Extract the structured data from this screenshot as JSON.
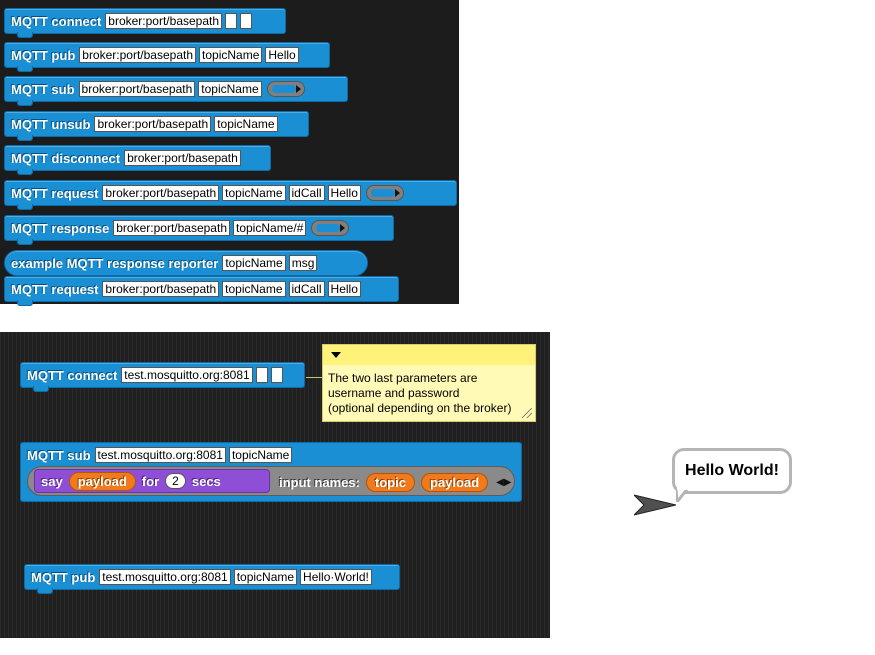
{
  "palette": {
    "blocks": [
      {
        "label": "MQTT connect",
        "slots": [
          "broker:port/basepath",
          "",
          ""
        ],
        "ring": false
      },
      {
        "label": "MQTT pub",
        "slots": [
          "broker:port/basepath",
          "topicName",
          "Hello"
        ],
        "ring": false
      },
      {
        "label": "MQTT sub",
        "slots": [
          "broker:port/basepath",
          "topicName"
        ],
        "ring": true
      },
      {
        "label": "MQTT unsub",
        "slots": [
          "broker:port/basepath",
          "topicName"
        ],
        "ring": false
      },
      {
        "label": "MQTT disconnect",
        "slots": [
          "broker:port/basepath"
        ],
        "ring": false
      },
      {
        "label": "MQTT request",
        "slots": [
          "broker:port/basepath",
          "topicName",
          "idCall",
          "Hello"
        ],
        "ring": true
      },
      {
        "label": "MQTT response",
        "slots": [
          "broker:port/basepath",
          "topicName/#"
        ],
        "ring": true
      },
      {
        "label": "example MQTT response reporter",
        "slots": [
          "topicName",
          "msg"
        ],
        "ring": false
      },
      {
        "label": "MQTT request",
        "slots": [
          "broker:port/basepath",
          "topicName",
          "idCall",
          "Hello"
        ],
        "ring": false
      }
    ]
  },
  "script": {
    "connect": {
      "label": "MQTT connect",
      "broker": "test.mosquitto.org:8081",
      "user": "",
      "password": ""
    },
    "comment": {
      "line1": "The two last parameters are",
      "line2": "username and password",
      "line3": "(optional depending on the broker)"
    },
    "sub": {
      "label": "MQTT sub",
      "broker": "test.mosquitto.org:8081",
      "topic": "topicName",
      "say_label": "say",
      "say_var": "payload",
      "for_label": "for",
      "seconds": "2",
      "secs_label": "secs",
      "input_names_label": "input names:",
      "param1": "topic",
      "param2": "payload"
    },
    "pub": {
      "label": "MQTT pub",
      "broker": "test.mosquitto.org:8081",
      "topic": "topicName",
      "message": "Hello·World!"
    }
  },
  "stage": {
    "bubble_text": "Hello World!"
  },
  "colors": {
    "motion_blue": "#1a8fd4",
    "looks_purple": "#8e4fd6",
    "variable_orange": "#f07a1c",
    "comment_yellow": "#fffab5"
  }
}
